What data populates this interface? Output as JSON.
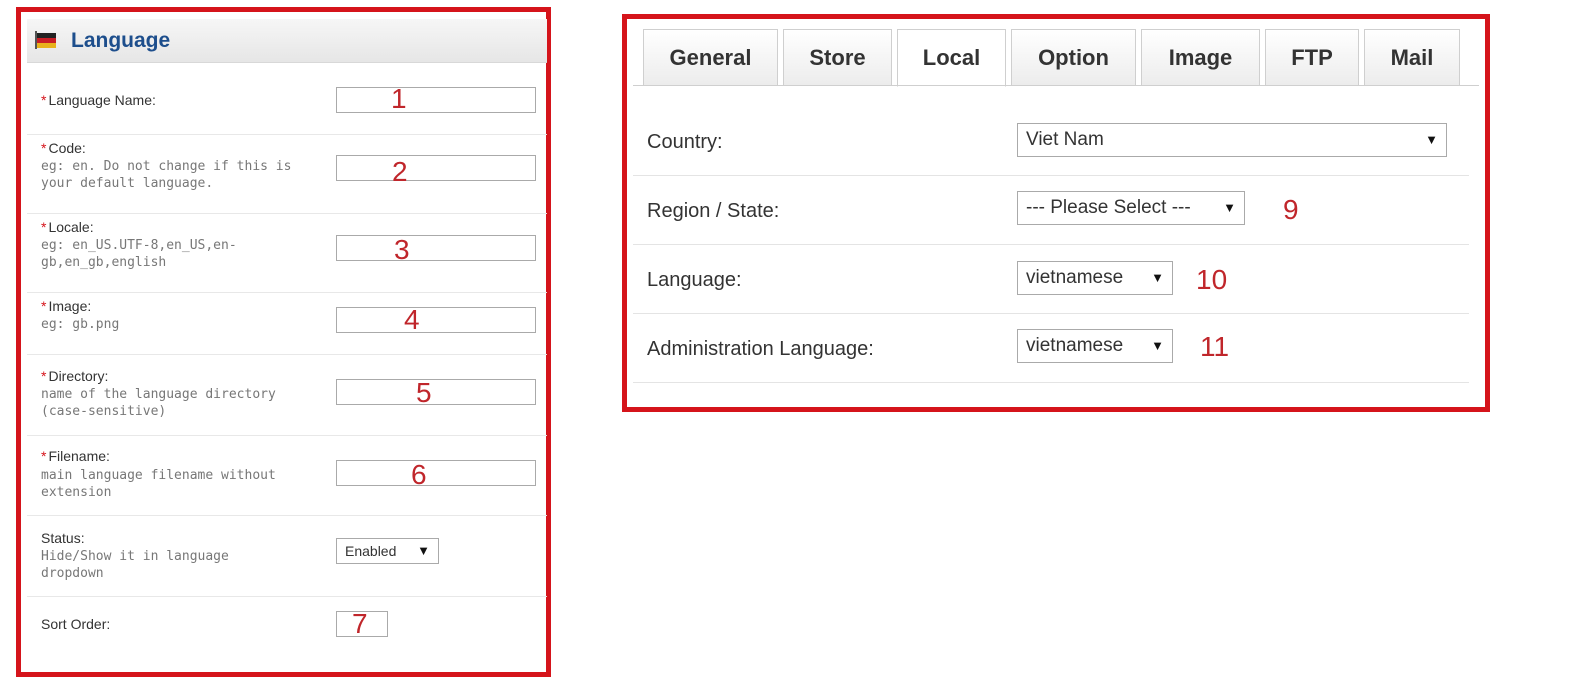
{
  "language_panel": {
    "title": "Language",
    "required_mark": "*",
    "rows": [
      {
        "label": "Language Name:",
        "help": "",
        "marker": "1"
      },
      {
        "label": "Code:",
        "help": "eg: en. Do not change if this is\nyour default language.",
        "marker": "2"
      },
      {
        "label": "Locale:",
        "help": "eg: en_US.UTF-8,en_US,en-\ngb,en_gb,english",
        "marker": "3"
      },
      {
        "label": "Image:",
        "help": "eg: gb.png",
        "marker": "4"
      },
      {
        "label": "Directory:",
        "help": "name of the language directory\n(case-sensitive)",
        "marker": "5"
      },
      {
        "label": "Filename:",
        "help": "main language filename without\nextension",
        "marker": "6"
      }
    ],
    "status": {
      "label": "Status:",
      "help": "Hide/Show it in language\ndropdown",
      "value": "Enabled"
    },
    "sort_order": {
      "label": "Sort Order:",
      "marker": "7"
    }
  },
  "settings_panel": {
    "tabs": [
      "General",
      "Store",
      "Local",
      "Option",
      "Image",
      "FTP",
      "Mail"
    ],
    "active_tab": "Local",
    "fields": {
      "country": {
        "label": "Country:",
        "value": "Viet Nam"
      },
      "region": {
        "label": "Region / State:",
        "value": "--- Please Select ---",
        "marker": "9"
      },
      "language": {
        "label": "Language:",
        "value": "vietnamese",
        "marker": "10"
      },
      "admin_language": {
        "label": "Administration Language:",
        "value": "vietnamese",
        "marker": "11"
      }
    }
  },
  "icons": {
    "header": "flag-icon",
    "select": "chevron-down-icon"
  },
  "colors": {
    "frame": "#d5141b",
    "marker": "#c0262b",
    "header_title": "#1d4e8c"
  }
}
